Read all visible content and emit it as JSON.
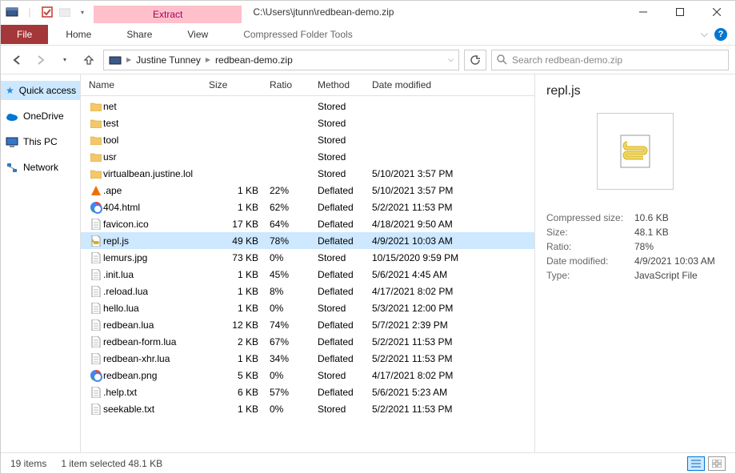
{
  "title": "C:\\Users\\jtunn\\redbean-demo.zip",
  "ribbon": {
    "extract": "Extract",
    "file": "File",
    "home": "Home",
    "share": "Share",
    "view": "View",
    "tools": "Compressed Folder Tools"
  },
  "breadcrumb": [
    "Justine Tunney",
    "redbean-demo.zip"
  ],
  "search": {
    "placeholder": "Search redbean-demo.zip"
  },
  "sidebar": [
    {
      "icon": "star",
      "label": "Quick access"
    },
    {
      "icon": "onedrive",
      "label": "OneDrive"
    },
    {
      "icon": "thispc",
      "label": "This PC"
    },
    {
      "icon": "network",
      "label": "Network"
    }
  ],
  "columns": {
    "name": "Name",
    "size": "Size",
    "ratio": "Ratio",
    "method": "Method",
    "date": "Date modified"
  },
  "files": [
    {
      "icon": "folder",
      "name": "net",
      "size": "",
      "ratio": "",
      "method": "Stored",
      "date": ""
    },
    {
      "icon": "folder",
      "name": "test",
      "size": "",
      "ratio": "",
      "method": "Stored",
      "date": ""
    },
    {
      "icon": "folder",
      "name": "tool",
      "size": "",
      "ratio": "",
      "method": "Stored",
      "date": ""
    },
    {
      "icon": "folder",
      "name": "usr",
      "size": "",
      "ratio": "",
      "method": "Stored",
      "date": ""
    },
    {
      "icon": "folder",
      "name": "virtualbean.justine.lol",
      "size": "",
      "ratio": "",
      "method": "Stored",
      "date": "5/10/2021 3:57 PM"
    },
    {
      "icon": "vlc",
      "name": ".ape",
      "size": "1 KB",
      "ratio": "22%",
      "method": "Deflated",
      "date": "5/10/2021 3:57 PM"
    },
    {
      "icon": "chrome",
      "name": "404.html",
      "size": "1 KB",
      "ratio": "62%",
      "method": "Deflated",
      "date": "5/2/2021 11:53 PM"
    },
    {
      "icon": "file",
      "name": "favicon.ico",
      "size": "17 KB",
      "ratio": "64%",
      "method": "Deflated",
      "date": "4/18/2021 9:50 AM"
    },
    {
      "icon": "js",
      "name": "repl.js",
      "size": "49 KB",
      "ratio": "78%",
      "method": "Deflated",
      "date": "4/9/2021 10:03 AM",
      "selected": true
    },
    {
      "icon": "file",
      "name": "lemurs.jpg",
      "size": "73 KB",
      "ratio": "0%",
      "method": "Stored",
      "date": "10/15/2020 9:59 PM"
    },
    {
      "icon": "file",
      "name": ".init.lua",
      "size": "1 KB",
      "ratio": "45%",
      "method": "Deflated",
      "date": "5/6/2021 4:45 AM"
    },
    {
      "icon": "file",
      "name": ".reload.lua",
      "size": "1 KB",
      "ratio": "8%",
      "method": "Deflated",
      "date": "4/17/2021 8:02 PM"
    },
    {
      "icon": "file",
      "name": "hello.lua",
      "size": "1 KB",
      "ratio": "0%",
      "method": "Stored",
      "date": "5/3/2021 12:00 PM"
    },
    {
      "icon": "file",
      "name": "redbean.lua",
      "size": "12 KB",
      "ratio": "74%",
      "method": "Deflated",
      "date": "5/7/2021 2:39 PM"
    },
    {
      "icon": "file",
      "name": "redbean-form.lua",
      "size": "2 KB",
      "ratio": "67%",
      "method": "Deflated",
      "date": "5/2/2021 11:53 PM"
    },
    {
      "icon": "file",
      "name": "redbean-xhr.lua",
      "size": "1 KB",
      "ratio": "34%",
      "method": "Deflated",
      "date": "5/2/2021 11:53 PM"
    },
    {
      "icon": "chrome",
      "name": "redbean.png",
      "size": "5 KB",
      "ratio": "0%",
      "method": "Stored",
      "date": "4/17/2021 8:02 PM"
    },
    {
      "icon": "file",
      "name": ".help.txt",
      "size": "6 KB",
      "ratio": "57%",
      "method": "Deflated",
      "date": "5/6/2021 5:23 AM"
    },
    {
      "icon": "file",
      "name": "seekable.txt",
      "size": "1 KB",
      "ratio": "0%",
      "method": "Stored",
      "date": "5/2/2021 11:53 PM"
    }
  ],
  "details": {
    "title": "repl.js",
    "labels": {
      "csize": "Compressed size:",
      "size": "Size:",
      "ratio": "Ratio:",
      "date": "Date modified:",
      "type": "Type:"
    },
    "values": {
      "csize": "10.6 KB",
      "size": "48.1 KB",
      "ratio": "78%",
      "date": "4/9/2021 10:03 AM",
      "type": "JavaScript File"
    }
  },
  "status": {
    "count": "19 items",
    "selection": "1 item selected  48.1 KB"
  }
}
